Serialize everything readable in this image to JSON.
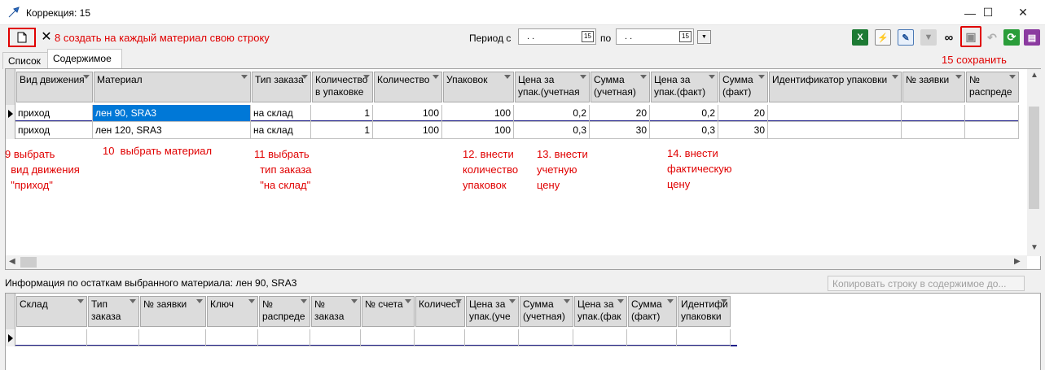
{
  "window": {
    "title": "Коррекция: 15",
    "minimize": "—",
    "maximize": "☐",
    "close": "✕"
  },
  "toolbar": {
    "delete_glyph": "✕",
    "period_label": "Период с",
    "period_from": ".  .",
    "period_to_label": "по",
    "period_to": ".  .",
    "calendar_glyph": "15",
    "dropdown_glyph": "▼"
  },
  "annotations": {
    "a8": "8 создать на каждый материал свою строку",
    "a15": "15 сохранить",
    "a9": "9 выбрать\n  вид движения\n  \"приход\"",
    "a10": "10  выбрать материал",
    "a11": "11 выбрать\n  тип заказа\n  \"на склад\"",
    "a12": "12. внести\nколичество\nупаковок",
    "a13": "13. внести\nучетную\nцену",
    "a14": "14. внести\nфактическую\nцену"
  },
  "tabs": [
    {
      "label": "Список"
    },
    {
      "label": "Содержимое"
    }
  ],
  "main_grid": {
    "columns": [
      "Вид движения",
      "Материал",
      "Тип заказа",
      "Количество\nв упаковке",
      "Количество",
      "Упаковок",
      "Цена за\nупак.(учетная",
      "Сумма\n(учетная)",
      "Цена за\nупак.(факт)",
      "Сумма\n(факт)",
      "Идентификатор упаковки",
      "№ заявки",
      "№\nраспреде"
    ],
    "rows": [
      [
        "приход",
        "лен 90, SRA3",
        "на склад",
        "1",
        "100",
        "100",
        "0,2",
        "20",
        "0,2",
        "20",
        "",
        "",
        ""
      ],
      [
        "приход",
        "лен 120, SRA3",
        "на склад",
        "1",
        "100",
        "100",
        "0,3",
        "30",
        "0,3",
        "30",
        "",
        "",
        ""
      ]
    ]
  },
  "info": {
    "text": "Информация по остаткам выбранного материала: лен 90, SRA3",
    "copy_button": "Копировать строку в содержимое до..."
  },
  "bottom_grid": {
    "columns": [
      "Склад",
      "Тип\nзаказа",
      "№ заявки",
      "Ключ",
      "№\nраспреде",
      "№\nзаказа",
      "№ счета",
      "Количест",
      "Цена за\nупак.(уче",
      "Сумма\n(учетная)",
      "Цена за\nупак.(фак",
      "Сумма\n(факт)",
      "Идентифи\nупаковки"
    ]
  },
  "icons": {
    "excel": "X",
    "lightning": "⚡",
    "edit": "✎",
    "pin": "▼",
    "binoculars": "∞",
    "save": "▣",
    "undo": "↶",
    "refresh": "⟳",
    "book": "▤"
  },
  "colors": {
    "annotation": "#e00000",
    "selection": "#0078d7",
    "excel": "#1d7a34",
    "refresh": "#2a9d3a"
  }
}
